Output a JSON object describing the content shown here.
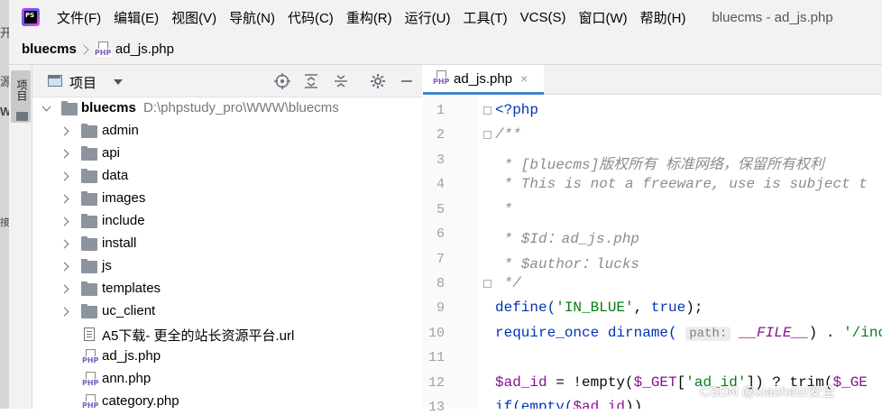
{
  "window": {
    "title": "bluecms - ad_js.php",
    "app_icon": "PS"
  },
  "menu": [
    "文件(F)",
    "编辑(E)",
    "视图(V)",
    "导航(N)",
    "代码(C)",
    "重构(R)",
    "运行(U)",
    "工具(T)",
    "VCS(S)",
    "窗口(W)",
    "帮助(H)"
  ],
  "left_strip": [
    "开",
    "源",
    "W",
    "接"
  ],
  "breadcrumb": {
    "root": "bluecms",
    "file": "ad_js.php"
  },
  "tool_window": {
    "tab_label": "项目"
  },
  "project": {
    "header_label": "项目",
    "root": {
      "name": "bluecms",
      "path": "D:\\phpstudy_pro\\WWW\\bluecms"
    },
    "folders": [
      "admin",
      "api",
      "data",
      "images",
      "include",
      "install",
      "js",
      "templates",
      "uc_client"
    ],
    "files": [
      {
        "name": "A5下载- 更全的站长资源平台.url",
        "type": "url"
      },
      {
        "name": "ad_js.php",
        "type": "php"
      },
      {
        "name": "ann.php",
        "type": "php"
      },
      {
        "name": "category.php",
        "type": "php"
      }
    ]
  },
  "editor": {
    "tab_label": "ad_js.php",
    "tab_close": "×",
    "line_numbers": [
      "1",
      "2",
      "3",
      "4",
      "5",
      "6",
      "7",
      "8",
      "9",
      "10",
      "11",
      "12",
      "13"
    ],
    "lines": {
      "l1": "<?php",
      "l2": "/**",
      "l3": " * [bluecms]版权所有 标准网络，保留所有权利",
      "l4": " * This is not a freeware, use is subject t",
      "l5": " *",
      "l6": " * $Id：ad_js.php",
      "l7": " * $author：lucks",
      "l8": " */",
      "l9a": "define(",
      "l9b": "'IN_BLUE'",
      "l9c": ", ",
      "l9d": "true",
      "l9e": ");",
      "l10a": "require_once dirname( ",
      "l10hint": "path:",
      "l10b": " __FILE__",
      "l10c": ") . ",
      "l10d": "'/inc",
      "l12a": "$ad_id",
      "l12b": " = !empty(",
      "l12c": "$_GET",
      "l12d": "[",
      "l12e": "'ad_id'",
      "l12f": "]) ? trim(",
      "l12g": "$_GE",
      "l13a": "if(empty(",
      "l13b": "$ad_id",
      "l13c": "))"
    }
  },
  "watermark": "CSDN @xiaoheizi安全",
  "colors": {
    "accent": "#4083c9",
    "keyword": "#0033b3",
    "string": "#067d17",
    "comment": "#8c8c8c",
    "variable": "#871094"
  }
}
